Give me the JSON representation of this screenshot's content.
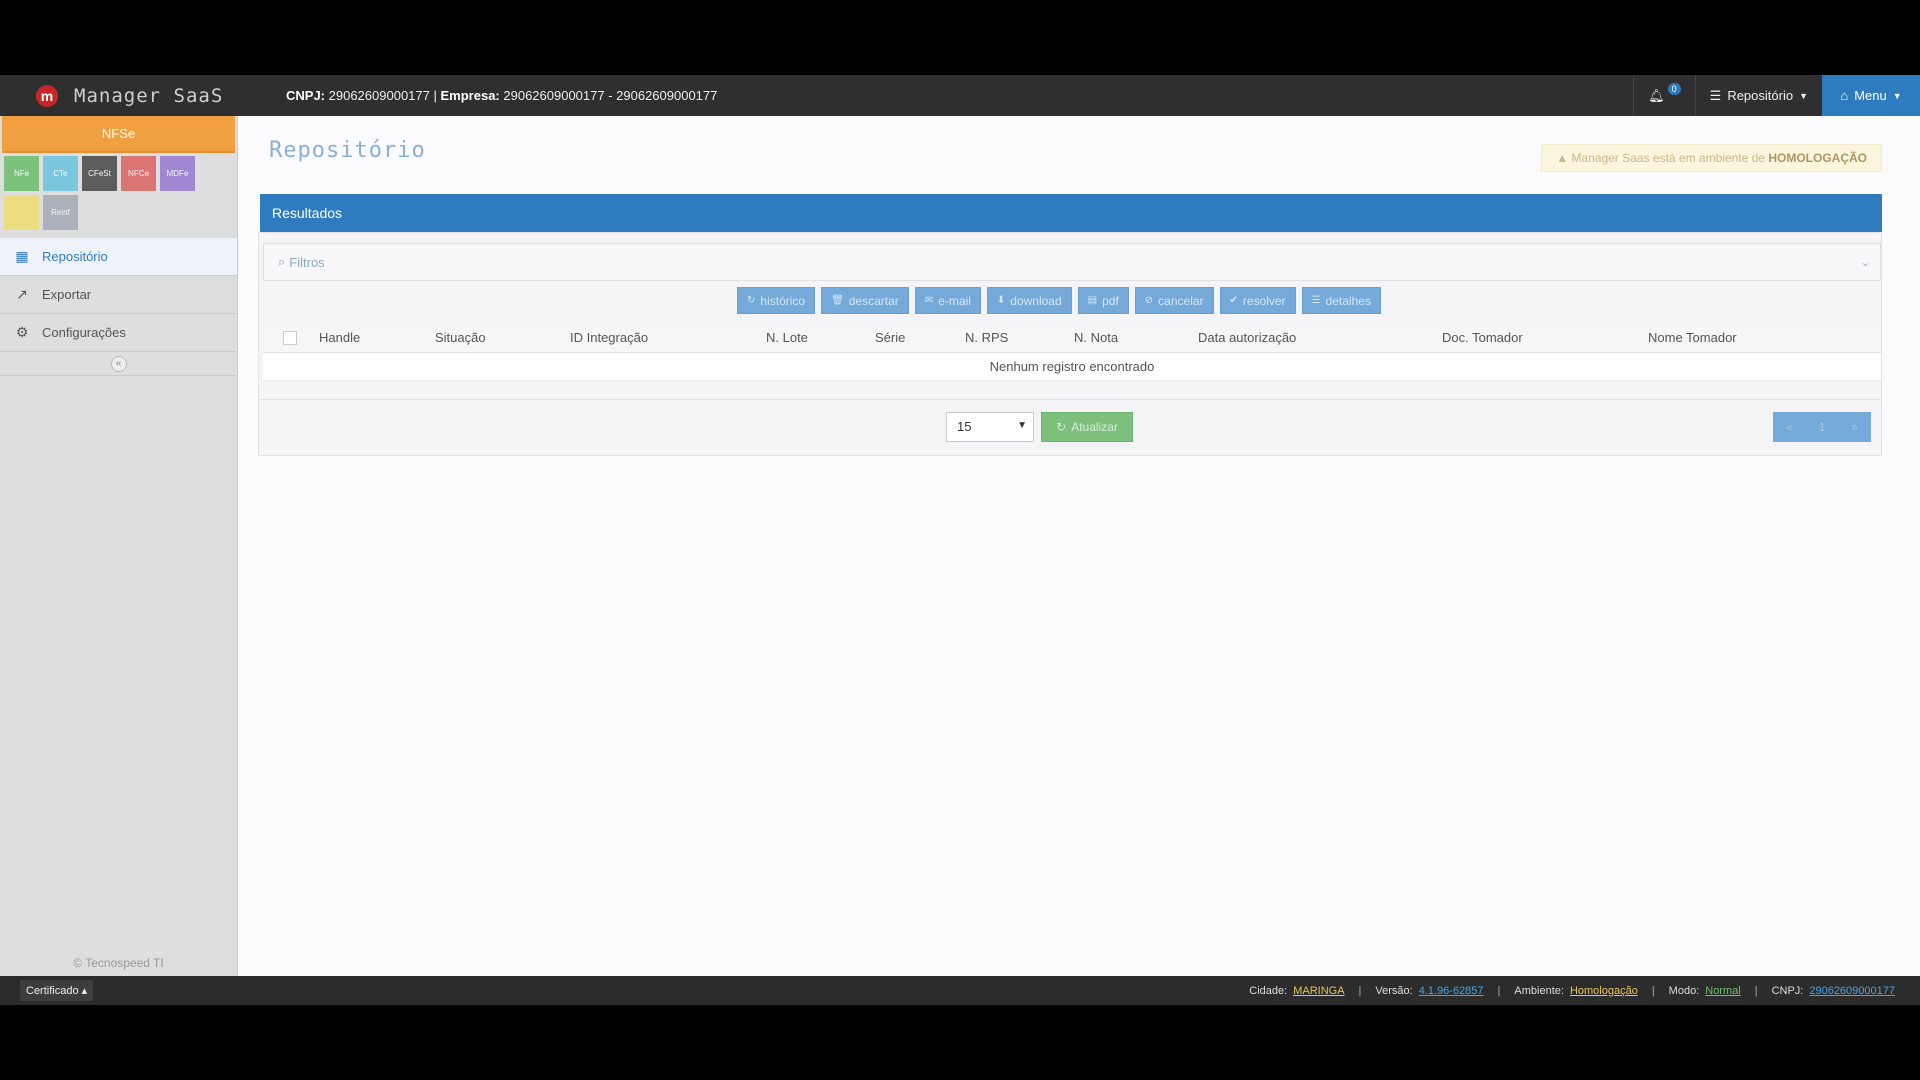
{
  "header": {
    "brand": "Manager SaaS",
    "logo_letter": "m",
    "cnpj_label": "CNPJ:",
    "cnpj_value": "29062609000177",
    "empresa_label": "Empresa:",
    "empresa_value": "29062609000177 - 29062609000177",
    "notifications_count": "0",
    "repositorio_label": "Repositório",
    "menu_label": "Menu"
  },
  "sidebar": {
    "active_doc": "NFSe",
    "modules": [
      {
        "label": "NFe",
        "color": "#5cb85c"
      },
      {
        "label": "CTe",
        "color": "#5bc0de"
      },
      {
        "label": "CFeSt",
        "color": "#333333"
      },
      {
        "label": "NFCe",
        "color": "#d9534f"
      },
      {
        "label": "MDFe",
        "color": "#8a6bd1"
      },
      {
        "label": "",
        "color": "#f0dc60"
      },
      {
        "label": "Reinf",
        "color": "#9aa4b0"
      }
    ],
    "items": [
      {
        "label": "Repositório",
        "icon": "table-icon"
      },
      {
        "label": "Exportar",
        "icon": "export-icon"
      },
      {
        "label": "Configurações",
        "icon": "gear-icon"
      }
    ],
    "collapse_icon": "«",
    "copyright": "© Tecnospeed TI"
  },
  "main": {
    "title": "Repositório",
    "env_alert_text": "Manager Saas está em ambiente de",
    "env_alert_strong": "HOMOLOGAÇÃO",
    "results_label": "Resultados",
    "filters_label": "Filtros",
    "actions": [
      {
        "label": "histórico",
        "icon": "↻"
      },
      {
        "label": "descartar",
        "icon": "🗑"
      },
      {
        "label": "e-mail",
        "icon": "✉"
      },
      {
        "label": "download",
        "icon": "⬇"
      },
      {
        "label": "pdf",
        "icon": "▤"
      },
      {
        "label": "cancelar",
        "icon": "⊘"
      },
      {
        "label": "resolver",
        "icon": "✔"
      },
      {
        "label": "detalhes",
        "icon": "☰"
      }
    ],
    "columns": [
      "Handle",
      "Situação",
      "ID Integração",
      "N. Lote",
      "Série",
      "N. RPS",
      "N. Nota",
      "Data autorização",
      "Doc. Tomador",
      "Nome Tomador"
    ],
    "empty_message": "Nenhum registro encontrado",
    "page_size": "15",
    "refresh_label": "Atualizar",
    "pagination": [
      "«",
      "1",
      "»"
    ]
  },
  "footer": {
    "cert_label": "Certificado",
    "cidade_label": "Cidade:",
    "cidade_value": "MARINGA",
    "versao_label": "Versão:",
    "versao_value": "4.1.96-62857",
    "ambiente_label": "Ambiente:",
    "ambiente_value": "Homologação",
    "modo_label": "Modo:",
    "modo_value": "Normal",
    "cnpj_label": "CNPJ:",
    "cnpj_value": "29062609000177"
  },
  "colors": {
    "primary": "#2f7bbf",
    "nfse_tab": "#f0a040",
    "success": "#7dc07d",
    "link_yellow": "#e6c65a",
    "link_blue": "#4aa3e0",
    "link_green": "#6fbf6f"
  }
}
